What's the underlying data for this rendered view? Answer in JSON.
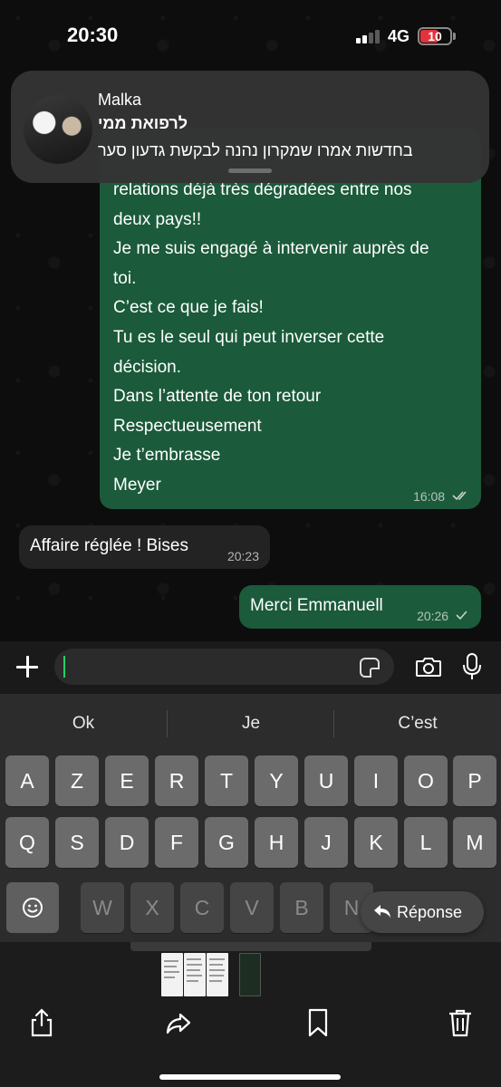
{
  "status_bar": {
    "time": "20:30",
    "network": "4G",
    "battery": "10",
    "battery_color": "#e3333a"
  },
  "notification": {
    "sender": "Malka",
    "title": "לרפואת ממי",
    "body": "בחדשות אמרו שמקרון נהנה לבקשת גדעון סער",
    "avatar": "group-photo"
  },
  "chat": {
    "outgoing_long": {
      "lines": [
        "relations déjà très dégradées entre nos",
        "deux pays!!",
        "Je me suis engagé à intervenir auprès de",
        "toi.",
        "C’est ce que je fais!",
        "Tu es le seul qui peut inverser cette",
        "décision.",
        "Dans l’attente de ton retour",
        "Respectueusement",
        "Je t’embrasse",
        "Meyer"
      ],
      "time": "16:08",
      "status": "read-double-check"
    },
    "incoming": {
      "text": "Affaire réglée ! Bises",
      "time": "20:23"
    },
    "outgoing_short": {
      "text": "Merci Emmanuell",
      "time": "20:26",
      "status": "sent-single-check"
    },
    "bubble_out_color": "#1b5a3a",
    "bubble_in_color": "#232323"
  },
  "input_bar": {
    "placeholder": "",
    "icons": [
      "plus-icon",
      "sticker-icon",
      "camera-icon",
      "microphone-icon"
    ]
  },
  "keyboard": {
    "suggestions": [
      "Ok",
      "Je",
      "C’est"
    ],
    "row1": [
      "A",
      "Z",
      "E",
      "R",
      "T",
      "Y",
      "U",
      "I",
      "O",
      "P"
    ],
    "row2": [
      "Q",
      "S",
      "D",
      "F",
      "G",
      "H",
      "J",
      "K",
      "L",
      "M"
    ],
    "row3": [
      "W",
      "X",
      "C",
      "V",
      "B",
      "N"
    ],
    "reply_label": "Réponse"
  },
  "bottom_bar": {
    "icons": [
      "share-icon",
      "forward-icon",
      "bookmark-icon",
      "trash-icon"
    ]
  }
}
